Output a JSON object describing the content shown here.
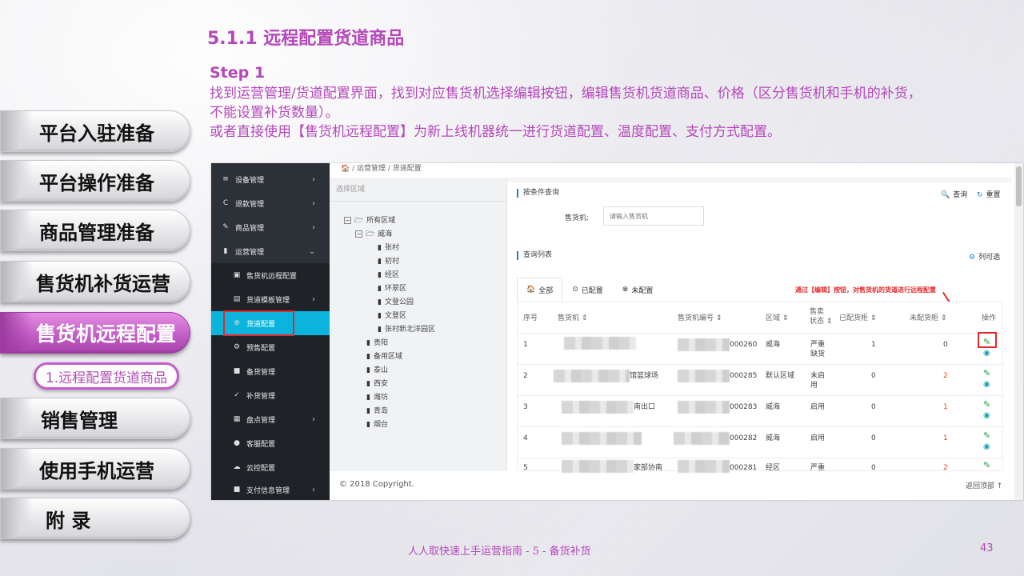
{
  "header": {
    "title": "5.1.1 远程配置货道商品",
    "step": "Step 1",
    "desc_line1": "找到运营管理/货道配置界面，找到对应售货机选择编辑按钮，编辑售货机货道商品、价格（区分售货机和手机的补货，",
    "desc_line2": "不能设置补货数量）。",
    "desc_line3": "或者直接使用【售货机远程配置】为新上线机器统一进行货道配置、温度配置、支付方式配置。"
  },
  "nav": {
    "items": [
      "平台入驻准备",
      "平台操作准备",
      "商品管理准备",
      "售货机补货运营",
      "售货机远程配置",
      "销售管理",
      "使用手机运营",
      "附 录"
    ],
    "sub_item": "1.远程配置货道商品"
  },
  "footer": {
    "text": "人人取快速上手运营指南 - 5 - 备货补货",
    "page": "43"
  },
  "screen": {
    "sidebar": [
      {
        "icon": "≡",
        "label": "设备管理",
        "arrow": "›"
      },
      {
        "icon": "C",
        "label": "退款管理",
        "arrow": "›"
      },
      {
        "icon": "✎",
        "label": "商品管理",
        "arrow": "›"
      },
      {
        "icon": "▮",
        "label": "运营管理",
        "arrow": "⌄"
      },
      {
        "icon": "▣",
        "label": "售货机远程配置",
        "arrow": ""
      },
      {
        "icon": "▤",
        "label": "货道模板管理",
        "arrow": "›"
      },
      {
        "icon": "⊕",
        "label": "货道配置",
        "arrow": ""
      },
      {
        "icon": "⚙",
        "label": "预售配置",
        "arrow": ""
      },
      {
        "icon": "■",
        "label": "备货管理",
        "arrow": ""
      },
      {
        "icon": "✓",
        "label": "补货管理",
        "arrow": ""
      },
      {
        "icon": "▦",
        "label": "盘点管理",
        "arrow": "›"
      },
      {
        "icon": "●",
        "label": "客服配置",
        "arrow": ""
      },
      {
        "icon": "☁",
        "label": "云控配置",
        "arrow": ""
      },
      {
        "icon": "■",
        "label": "支付信息管理",
        "arrow": "›"
      }
    ],
    "breadcrumb": "🏠 /  运营管理  /  货道配置",
    "tree": {
      "head": "选择区域",
      "nodes": [
        "所有区域",
        "威海",
        "张村",
        "初村",
        "经区",
        "环翠区",
        "文登公园",
        "文登区",
        "张村新北洋园区",
        "贵阳",
        "备用区域",
        "泰山",
        "西安",
        "潍坊",
        "青岛",
        "烟台"
      ]
    },
    "query": {
      "title": "按条件查询",
      "search_btn": "查询",
      "reset_btn": "重置",
      "machine_label": "售货机:",
      "machine_placeholder": "请输入售货机"
    },
    "list": {
      "title": "查询列表",
      "columns_btn": "列可选",
      "tabs": [
        "全部",
        "已配置",
        "未配置"
      ],
      "annotation": "通过【编辑】按钮，对售货机的货道进行远程配置",
      "headers": {
        "idx": "序号",
        "machine": "售货机 ⇕",
        "code": "售货机编号 ⇕",
        "area": "区域 ⇕",
        "status1": "售卖",
        "status2": "状态 ⇕",
        "configured": "已配货柜 ⇕",
        "unconfigured": "未配货柜 ⇕",
        "op": "操作"
      },
      "rows": [
        {
          "idx": "1",
          "name_tail": "",
          "code_tail": "000260",
          "area": "威海",
          "status1": "严重",
          "status2": "缺货",
          "configured": "1",
          "unconfigured": "0"
        },
        {
          "idx": "2",
          "name_tail": "馆篮球场",
          "code_tail": "000285",
          "area": "默认区域",
          "status1": "未启",
          "status2": "用",
          "configured": "0",
          "unconfigured": "2"
        },
        {
          "idx": "3",
          "name_tail": "南出口",
          "code_tail": "000283",
          "area": "威海",
          "status1": "启用",
          "status2": "",
          "configured": "0",
          "unconfigured": "1"
        },
        {
          "idx": "4",
          "name_tail": "",
          "code_tail": "000282",
          "area": "威海",
          "status1": "启用",
          "status2": "",
          "configured": "0",
          "unconfigured": "1"
        },
        {
          "idx": "5",
          "name_tail": "家部协南",
          "code_tail": "000281",
          "area": "经区",
          "status1": "严重",
          "status2": "",
          "configured": "0",
          "unconfigured": "2"
        }
      ]
    },
    "copyright": "© 2018 Copyright.",
    "to_top": "返回顶部 ↑"
  },
  "colors": {
    "accent": "#b448b9",
    "sidebar": "#2c3138",
    "selected": "#0ab4dc",
    "highlight": "#e22a2a"
  }
}
